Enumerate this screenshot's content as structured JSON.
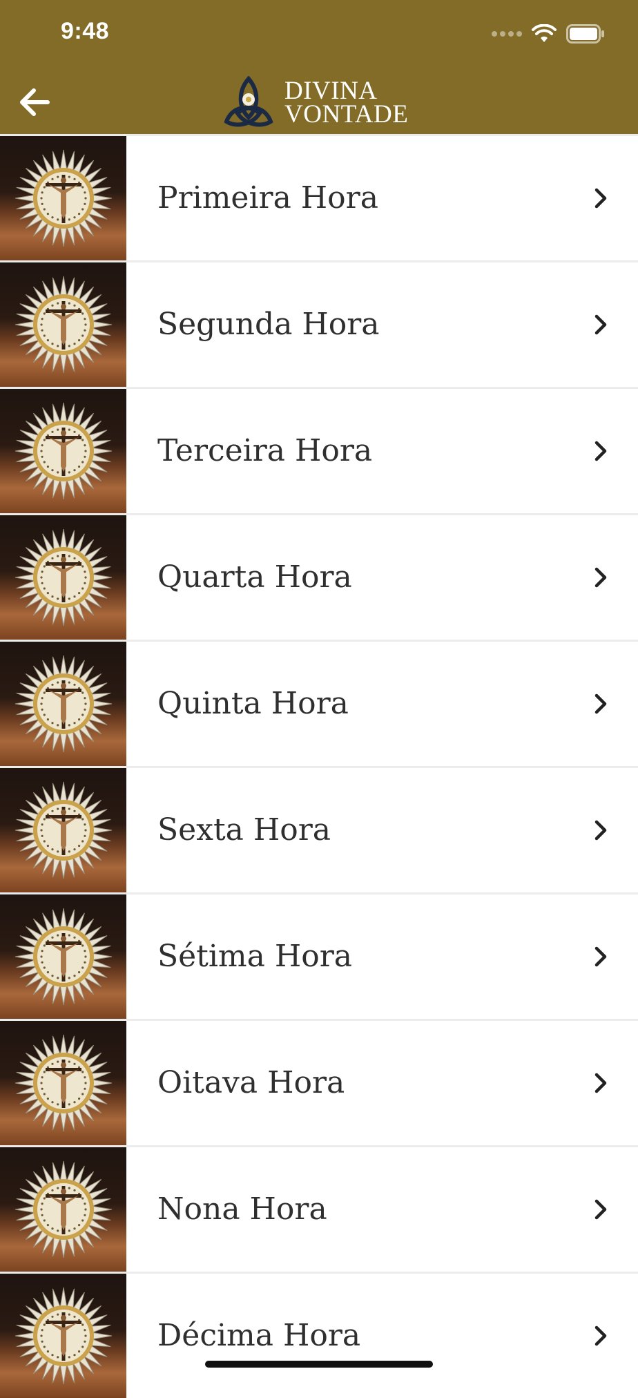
{
  "status_bar": {
    "time": "9:48"
  },
  "header": {
    "logo_line1": "DIVINA",
    "logo_line2": "VONTADE",
    "back_icon": "arrow-left-icon",
    "background_color": "#836c27"
  },
  "hours": [
    {
      "label": "Primeira Hora"
    },
    {
      "label": "Segunda Hora"
    },
    {
      "label": "Terceira Hora"
    },
    {
      "label": "Quarta Hora"
    },
    {
      "label": "Quinta Hora"
    },
    {
      "label": "Sexta Hora"
    },
    {
      "label": "Sétima Hora"
    },
    {
      "label": "Oitava Hora"
    },
    {
      "label": "Nona Hora"
    },
    {
      "label": "Décima Hora"
    }
  ]
}
